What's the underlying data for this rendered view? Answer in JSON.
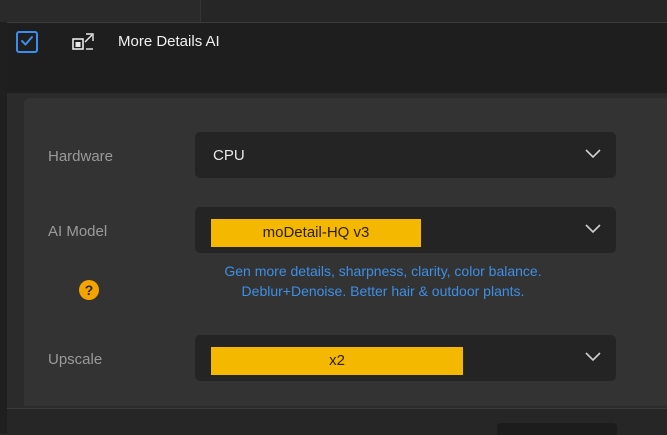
{
  "header": {
    "enabled": true,
    "title": "More Details AI",
    "icon": "enhance-square-icon"
  },
  "settings": {
    "hardware": {
      "label": "Hardware",
      "value": "CPU"
    },
    "ai_model": {
      "label": "AI Model",
      "value": "moDetail-HQ  v3"
    },
    "help": {
      "icon": "?",
      "line1": "Gen more details, sharpness, clarity, color balance.",
      "line2": "Deblur+Denoise. Better hair & outdoor plants."
    },
    "upscale": {
      "label": "Upscale",
      "value": "x2"
    }
  },
  "colors": {
    "accent_blue": "#3b8ef0",
    "highlight_yellow": "#f5b800",
    "help_orange": "#f5a300",
    "help_text_blue": "#3e8fe6"
  }
}
